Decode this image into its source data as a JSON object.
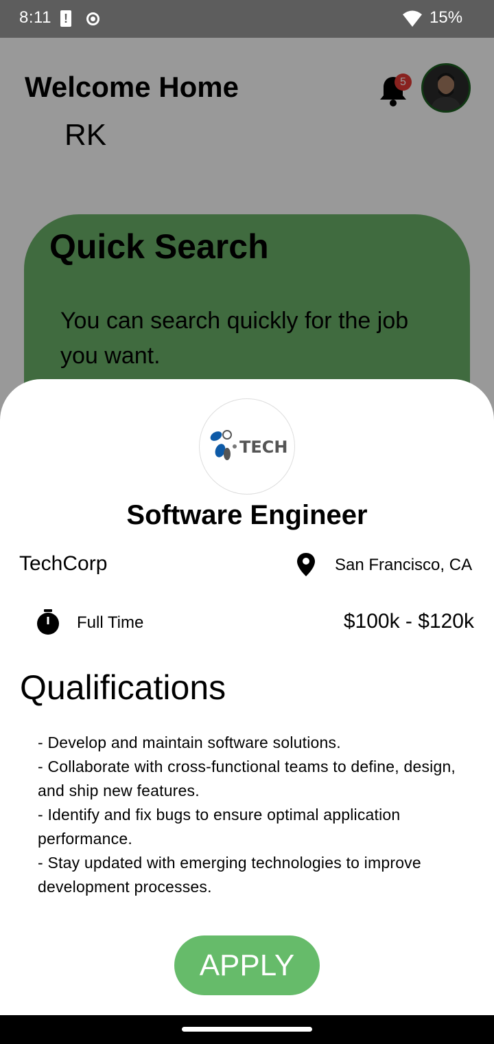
{
  "status_bar": {
    "time": "8:11",
    "battery": "15%"
  },
  "header": {
    "title": "Welcome Home",
    "name": "RK",
    "notification_count": "5"
  },
  "quick_search": {
    "title": "Quick Search",
    "description": "You can search quickly for the job you want."
  },
  "job": {
    "logo_text": "TECH",
    "title": "Software Engineer",
    "company": "TechCorp",
    "location": "San Francisco, CA",
    "type": "Full Time",
    "salary": "$100k - $120k",
    "qualifications_heading": "Qualifications",
    "qualifications": [
      "- Develop and maintain software solutions.",
      "- Collaborate with cross-functional teams to define, design, and ship new features.",
      "- Identify and fix bugs to ensure optimal application performance.",
      "- Stay updated with emerging technologies to improve development processes."
    ],
    "apply_label": "APPLY"
  },
  "colors": {
    "accent": "#66bb6a",
    "card": "#6bb36a",
    "badge": "#e53935"
  }
}
